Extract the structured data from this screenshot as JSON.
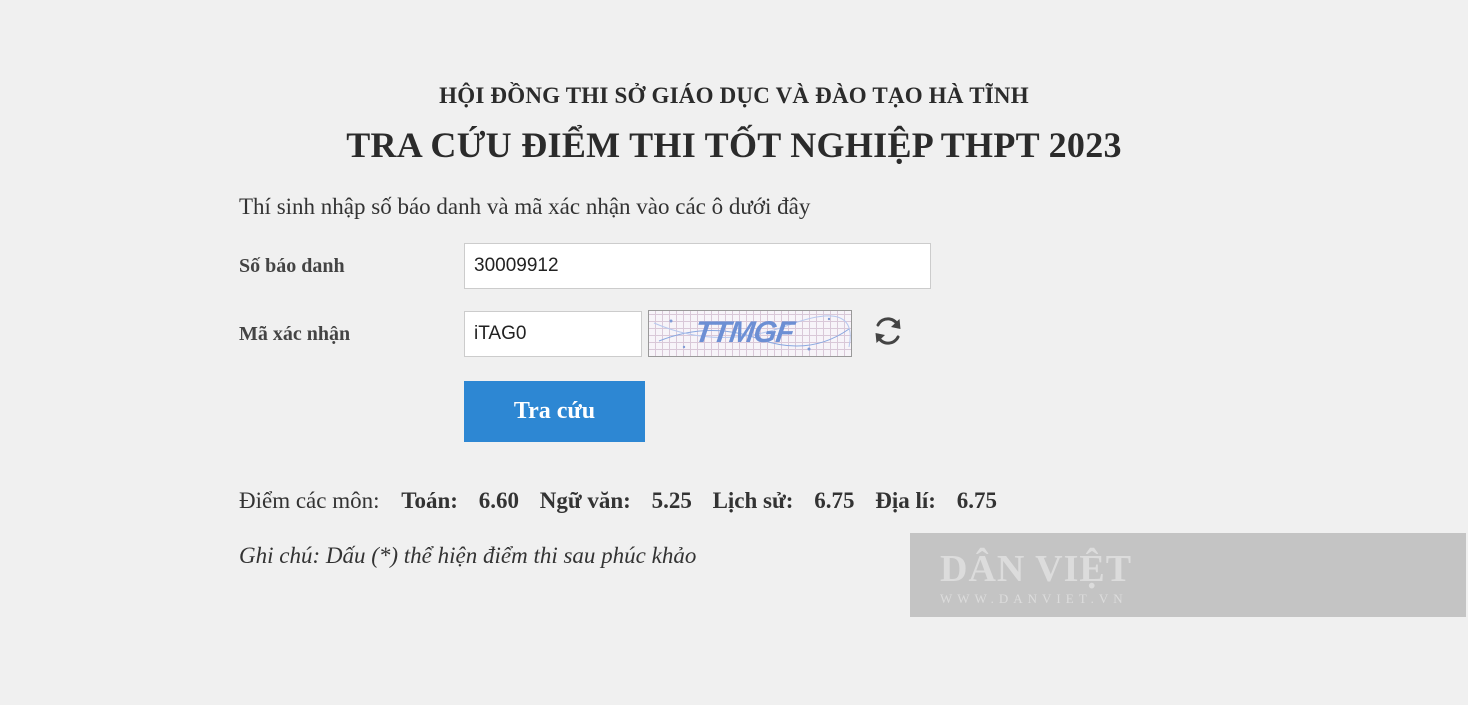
{
  "header": {
    "council": "HỘI ĐỒNG THI SỞ GIÁO DỤC VÀ ĐÀO TẠO HÀ TĨNH",
    "title": "TRA CỨU ĐIỂM THI TỐT NGHIỆP THPT 2023"
  },
  "form": {
    "instructions": "Thí sinh nhập số báo danh và mã xác nhận vào các ô dưới đây",
    "candidate_number_label": "Số báo danh",
    "candidate_number_value": "30009912",
    "captcha_label": "Mã xác nhận",
    "captcha_value": "iTAG0",
    "captcha_image_text": "TTMGF",
    "refresh_icon": "refresh-icon",
    "submit_label": "Tra cứu",
    "submit_color": "#2d87d3"
  },
  "results": {
    "intro": "Điểm các môn:",
    "subjects": [
      {
        "name": "Toán:",
        "score": "6.60"
      },
      {
        "name": "Ngữ văn:",
        "score": "5.25"
      },
      {
        "name": "Lịch sử:",
        "score": "6.75"
      },
      {
        "name": "Địa lí:",
        "score": "6.75"
      }
    ],
    "note": "Ghi chú: Dấu (*) thể hiện điểm thi sau phúc khảo"
  },
  "watermark": {
    "logo": "DÂN VIỆT",
    "url": "WWW.DANVIET.VN"
  }
}
